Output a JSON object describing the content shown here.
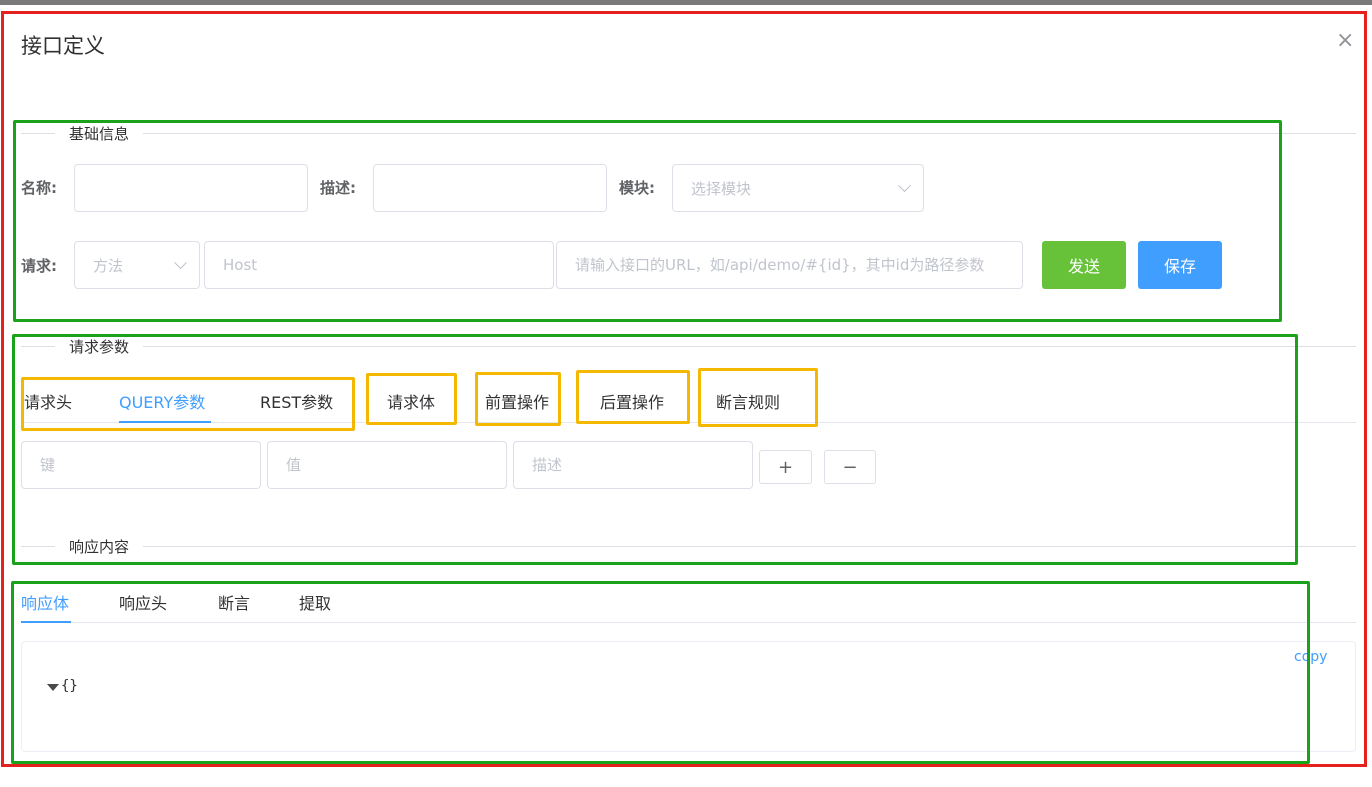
{
  "dialog": {
    "title": "接口定义",
    "close_glyph": "×"
  },
  "sections": {
    "basic": "基础信息",
    "request_params": "请求参数",
    "response": "响应内容"
  },
  "basic": {
    "name_label": "名称:",
    "name_value": "",
    "desc_label": "描述:",
    "desc_value": "",
    "module_label": "模块:",
    "module_placeholder": "选择模块",
    "request_label": "请求:",
    "method_placeholder": "方法",
    "host_placeholder": "Host",
    "url_placeholder": "请输入接口的URL，如/api/demo/#{id}，其中id为路径参数",
    "send_label": "发送",
    "save_label": "保存"
  },
  "request_tabs": [
    {
      "label": "请求头"
    },
    {
      "label": "QUERY参数",
      "active": true
    },
    {
      "label": "REST参数"
    },
    {
      "label": "请求体"
    },
    {
      "label": "前置操作"
    },
    {
      "label": "后置操作"
    },
    {
      "label": "断言规则"
    }
  ],
  "kv_row": {
    "key_placeholder": "键",
    "value_placeholder": "值",
    "desc_placeholder": "描述",
    "add_glyph": "+",
    "remove_glyph": "−"
  },
  "response_tabs": [
    {
      "label": "响应体",
      "active": true
    },
    {
      "label": "响应头"
    },
    {
      "label": "断言"
    },
    {
      "label": "提取"
    }
  ],
  "response_body": {
    "copy_label": "copy",
    "json_text": "{}"
  },
  "colors": {
    "primary": "#409eff",
    "success": "#67c23a",
    "annotation_red": "#e5201d",
    "annotation_green": "#1aa31a",
    "annotation_yellow": "#f5b800"
  }
}
